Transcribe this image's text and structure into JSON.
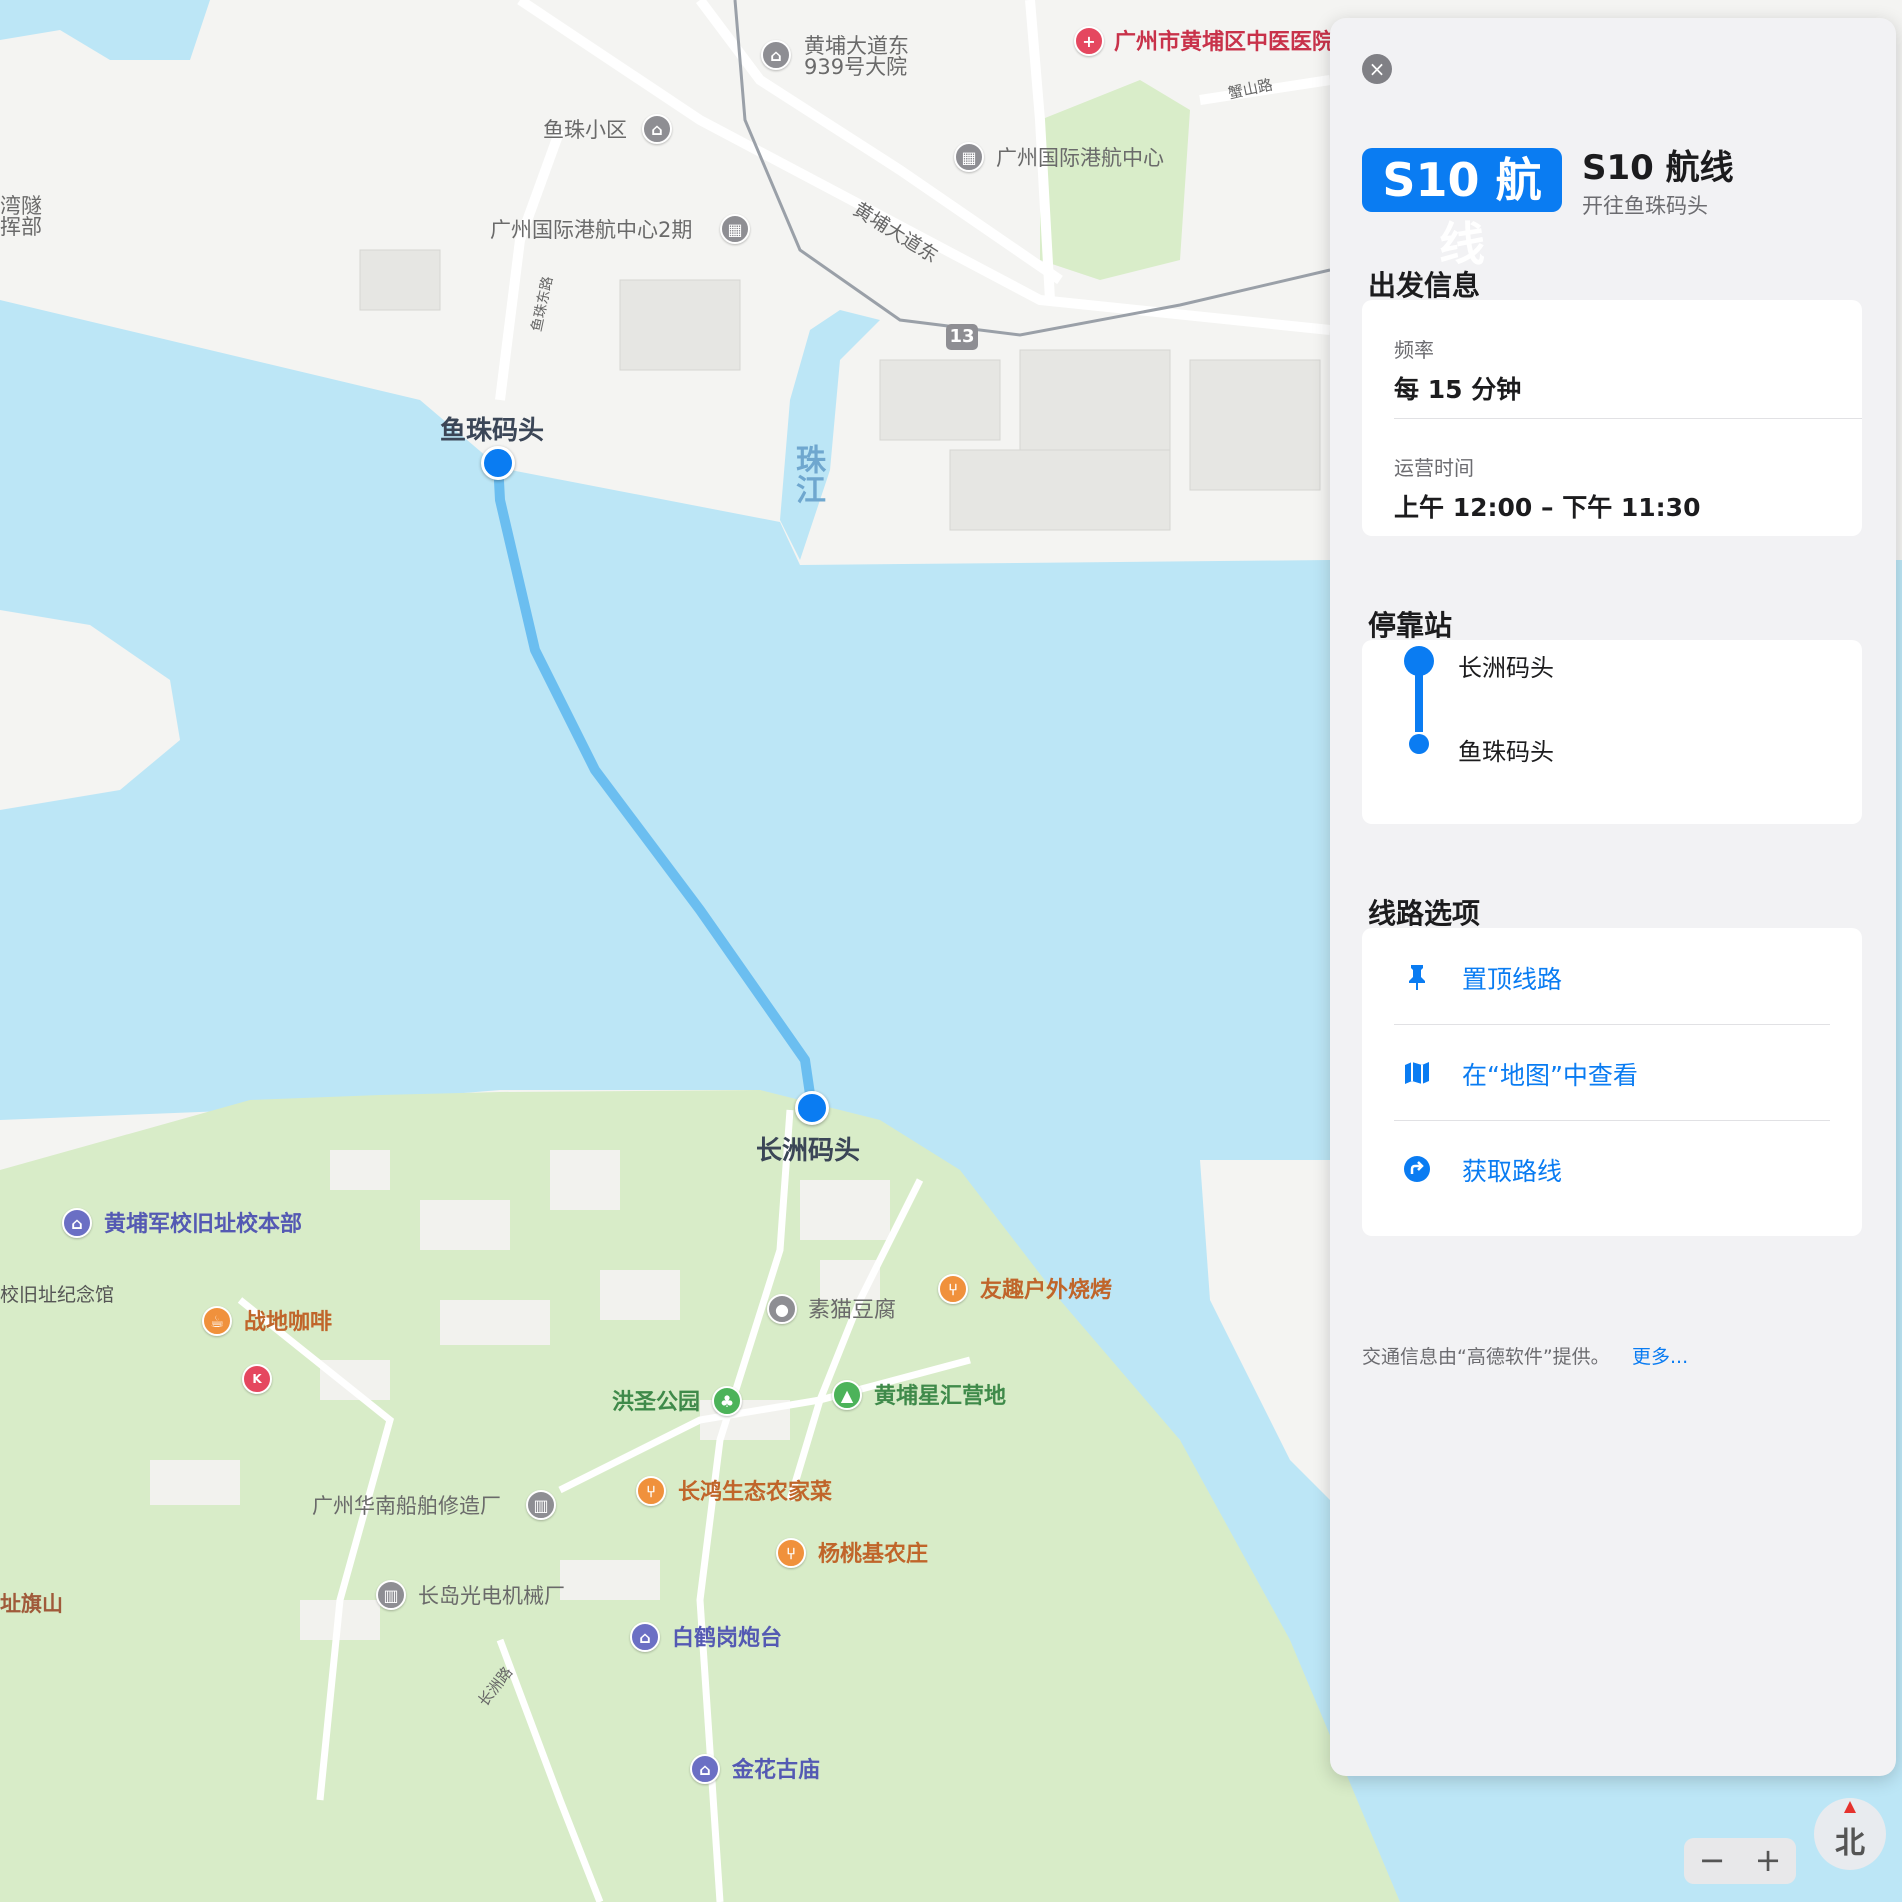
{
  "map": {
    "labels": {
      "huangpu_939": "黄埔大道东\n939号大院",
      "yuzhu_xiaoqu": "鱼珠小区",
      "gj_hangyun_2": "广州国际港航中心2期",
      "gj_hangyun": "广州国际港航中心",
      "hospital": "广州市黄埔区中医医院",
      "huangpu_dadao": "黄埔大道东",
      "pan_shan_lu": "蟹山路",
      "tunnel_hq": "湾隧\n挥部",
      "yuzhu_east_rd": "鱼珠东路",
      "road_13": "13",
      "zhujiang": "珠江",
      "junxiao": "黄埔军校旧址校本部",
      "jinianguan": "校旧址纪念馆",
      "coffee": "战地咖啡",
      "sumao": "素猫豆腐",
      "bbq": "友趣户外烧烤",
      "hongsheng": "洪圣公园",
      "xinghui": "黄埔星汇营地",
      "changhong": "长鸿生态农家菜",
      "shipyard": "广州华南船舶修造厂",
      "yangtao": "杨桃基农庄",
      "changdao": "长岛光电机械厂",
      "baihegang": "白鹤岗炮台",
      "qishan": "址旗山",
      "changzhou_rd": "长洲路",
      "jinhua": "金花古庙"
    },
    "stops": {
      "yuzhu": "鱼珠码头",
      "changzhou": "长洲码头"
    }
  },
  "panel": {
    "badge": "S10 航线",
    "title": "S10 航线",
    "subtitle": "开往鱼珠码头",
    "departure": {
      "section": "出发信息",
      "freq_label": "频率",
      "freq_value": "每 15 分钟",
      "hours_label": "运营时间",
      "hours_value": "上午 12:00 – 下午 11:30"
    },
    "stops": {
      "section": "停靠站",
      "items": [
        "长洲码头",
        "鱼珠码头"
      ]
    },
    "options": {
      "section": "线路选项",
      "pin": "置顶线路",
      "view_in_maps": "在“地图”中查看",
      "directions": "获取路线"
    },
    "footer": {
      "text": "交通信息由“高德软件”提供。",
      "more": "更多..."
    }
  },
  "controls": {
    "zoom_out": "−",
    "zoom_in": "+",
    "compass": "北"
  },
  "colors": {
    "water": "#bce6f6",
    "land_north": "#f4f4f2",
    "land_south": "#d8ecc8",
    "route": "#6bbef0",
    "accent": "#0a7cf2"
  }
}
